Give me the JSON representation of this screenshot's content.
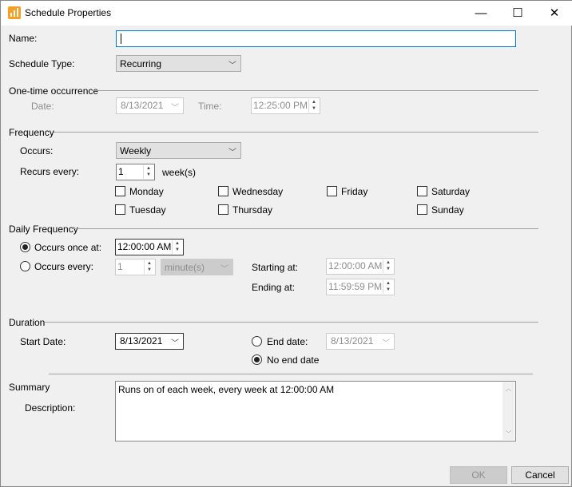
{
  "window": {
    "title": "Schedule Properties",
    "minimize": "—",
    "maximize": "☐",
    "close": "✕"
  },
  "name": {
    "label": "Name:",
    "value": ""
  },
  "schedule_type": {
    "label": "Schedule Type:",
    "value": "Recurring"
  },
  "one_time": {
    "header": "One-time occurrence",
    "date_label": "Date:",
    "date": "8/13/2021",
    "time_label": "Time:",
    "time": "12:25:00 PM"
  },
  "frequency": {
    "header": "Frequency",
    "occurs_label": "Occurs:",
    "occurs": "Weekly",
    "recurs_label": "Recurs every:",
    "recurs_value": "1",
    "recurs_unit": "week(s)",
    "days": [
      {
        "label": "Monday",
        "checked": false
      },
      {
        "label": "Wednesday",
        "checked": false
      },
      {
        "label": "Friday",
        "checked": false
      },
      {
        "label": "Saturday",
        "checked": false
      },
      {
        "label": "Tuesday",
        "checked": false
      },
      {
        "label": "Thursday",
        "checked": false
      },
      {
        "label": "Sunday",
        "checked": false
      }
    ]
  },
  "daily": {
    "header": "Daily Frequency",
    "once_label": "Occurs once at:",
    "once_time": "12:00:00 AM",
    "every_label": "Occurs every:",
    "every_value": "1",
    "every_unit": "minute(s)",
    "start_label": "Starting at:",
    "start_time": "12:00:00 AM",
    "end_label": "Ending at:",
    "end_time": "11:59:59 PM"
  },
  "duration": {
    "header": "Duration",
    "start_label": "Start Date:",
    "start_date": "8/13/2021",
    "end_label": "End date:",
    "end_date": "8/13/2021",
    "no_end_label": "No end date"
  },
  "summary": {
    "header": "Summary",
    "desc_label": "Description:",
    "text": "Runs on  of each week, every week at 12:00:00 AM"
  },
  "buttons": {
    "ok": "OK",
    "cancel": "Cancel"
  }
}
